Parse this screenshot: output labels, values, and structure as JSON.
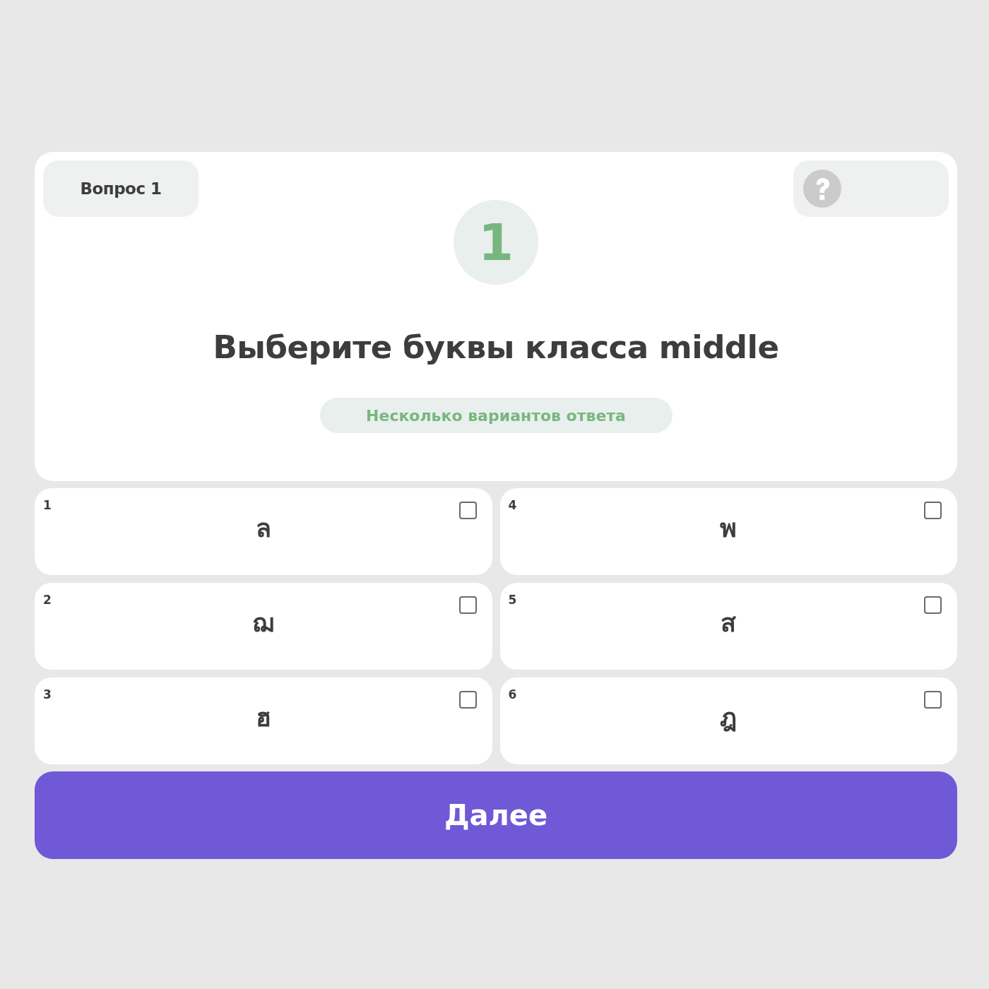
{
  "question": {
    "label": "Вопрос 1",
    "number": "1",
    "title": "Выберите буквы класса middle",
    "answer_type": "Несколько вариантов ответа"
  },
  "help_button": {
    "kind": "help"
  },
  "options": [
    {
      "number": "1",
      "letter": "ล",
      "checked": false
    },
    {
      "number": "2",
      "letter": "ฌ",
      "checked": false
    },
    {
      "number": "3",
      "letter": "ฮ",
      "checked": false
    },
    {
      "number": "4",
      "letter": "พ",
      "checked": false
    },
    {
      "number": "5",
      "letter": "ส",
      "checked": false
    },
    {
      "number": "6",
      "letter": "ฎ",
      "checked": false
    }
  ],
  "next_button": {
    "label": "Далее"
  }
}
